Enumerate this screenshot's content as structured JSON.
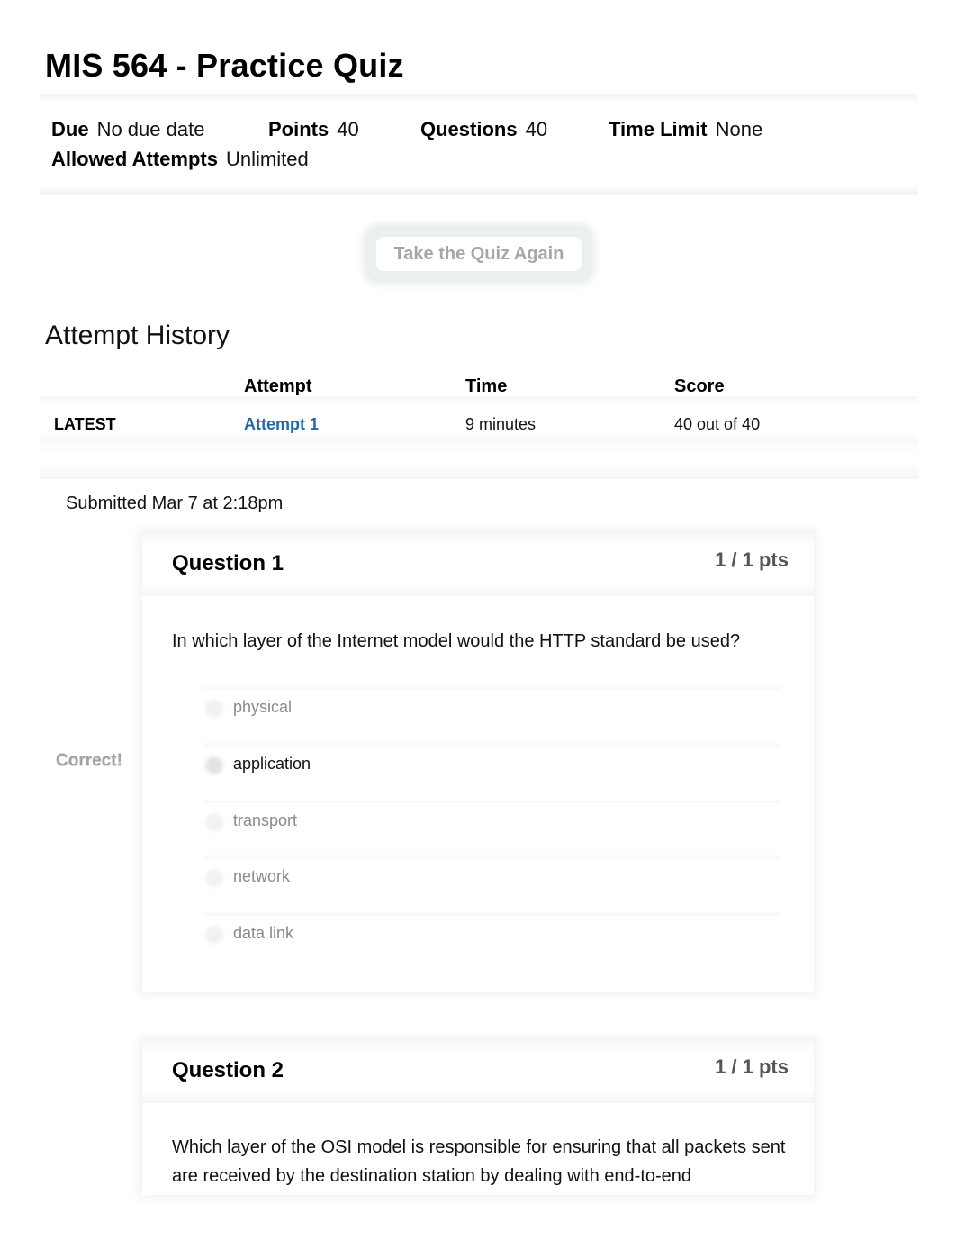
{
  "quiz": {
    "title": "MIS 564 - Practice Quiz",
    "meta": {
      "due_label": "Due",
      "due_value": "No due date",
      "points_label": "Points",
      "points_value": "40",
      "questions_label": "Questions",
      "questions_value": "40",
      "time_limit_label": "Time Limit",
      "time_limit_value": "None",
      "attempts_label": "Allowed Attempts",
      "attempts_value": "Unlimited"
    },
    "retake_button": "Take the Quiz Again"
  },
  "history": {
    "title": "Attempt History",
    "columns": [
      "",
      "Attempt",
      "Time",
      "Score"
    ],
    "rows": [
      {
        "tag": "LATEST",
        "attempt": "Attempt 1",
        "time": "9 minutes",
        "score": "40 out of 40"
      }
    ]
  },
  "submission": {
    "text": "Submitted Mar 7 at 2:18pm"
  },
  "questions": [
    {
      "title": "Question 1",
      "points": "1 / 1 pts",
      "text": "In which layer of the Internet model would the HTTP standard be used?",
      "feedback": "Correct!",
      "answers": [
        {
          "label": "physical",
          "selected": false
        },
        {
          "label": "application",
          "selected": true
        },
        {
          "label": "transport",
          "selected": false
        },
        {
          "label": "network",
          "selected": false
        },
        {
          "label": "data link",
          "selected": false
        }
      ]
    },
    {
      "title": "Question 2",
      "points": "1 / 1 pts",
      "text": "Which layer of the OSI model is responsible for ensuring that all packets sent are received by the destination station by dealing with end-to-end"
    }
  ],
  "colors": {
    "link": "#1f6aa5",
    "muted_answer": "#8a8a8a",
    "points": "#555555"
  }
}
